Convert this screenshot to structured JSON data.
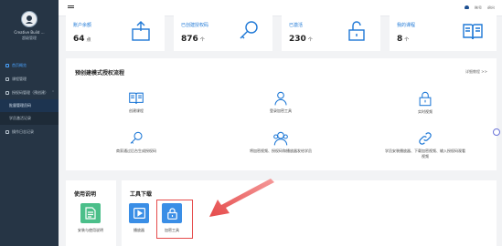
{
  "sidebar": {
    "user_name": "Creative Build …",
    "user_sub": "超级管理",
    "items": [
      {
        "label": "首页概览"
      },
      {
        "label": "课程管理"
      },
      {
        "label": "授权码管理（预创建）",
        "subitems": [
          "批量管理员码",
          "学员激活记录"
        ]
      },
      {
        "label": "操作日志记录"
      }
    ]
  },
  "topbar": {
    "user_label": "账号",
    "logout_label": "退出"
  },
  "stats": [
    {
      "label": "账户余额",
      "value": "64",
      "unit": "点",
      "icon": "box-upload-icon"
    },
    {
      "label": "已创建授权码",
      "value": "876",
      "unit": "个",
      "icon": "key-icon"
    },
    {
      "label": "已激活",
      "value": "230",
      "unit": "个",
      "icon": "unlock-icon"
    },
    {
      "label": "我的课程",
      "value": "8",
      "unit": "个",
      "icon": "book-open-icon"
    }
  ],
  "process": {
    "title": "预创建模式授权流程",
    "link": "详细教程 >>",
    "steps": [
      {
        "label": "创建课程",
        "icon": "book-open-icon"
      },
      {
        "label": "登录加密工具",
        "icon": "user-icon"
      },
      {
        "label": "实时视频",
        "icon": "lock-icon"
      },
      {
        "label": "商家通过后台生成授权码",
        "icon": "key-icon"
      },
      {
        "label": "将加密视频、授权码和播放器发给学员",
        "icon": "users-icon"
      },
      {
        "label": "学员安装播放器、下载加密视频、输入授权码观看视频",
        "icon": "link-icon"
      }
    ]
  },
  "usage": {
    "title": "使用说明",
    "item_label": "安装与使用说明"
  },
  "tools": {
    "title": "工具下载",
    "items": [
      {
        "label": "播放器",
        "icon": "play-icon"
      },
      {
        "label": "加密工具",
        "icon": "lock-icon"
      }
    ]
  },
  "colors": {
    "accent": "#1e78d6",
    "sidebar": "#263545",
    "tile_blue": "#3a8ee6",
    "tile_green": "#4bbf8a",
    "arrow": "#e54b4b"
  }
}
